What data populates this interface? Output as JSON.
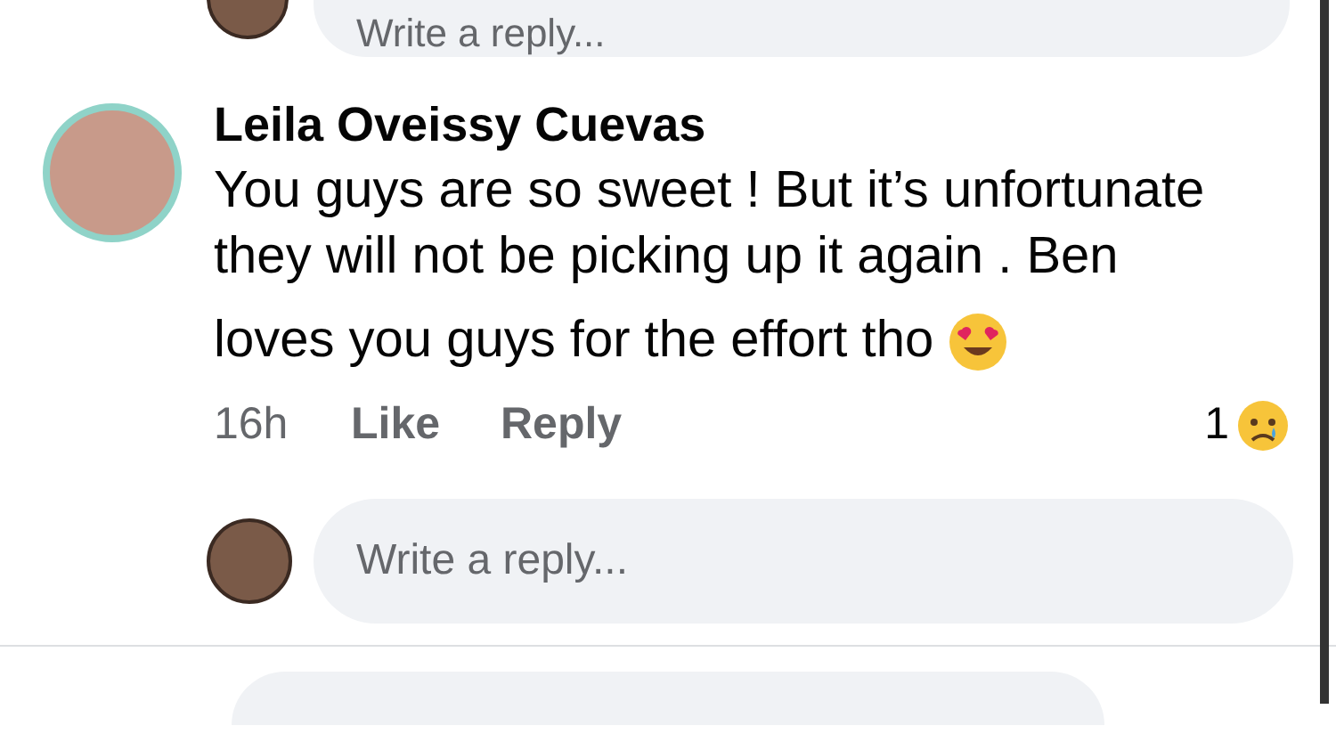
{
  "top_reply_box": {
    "placeholder": "Write a reply..."
  },
  "comment": {
    "author": "Leila Oveissy Cuevas",
    "lines": [
      "You guys are so sweet ! But it’s unfortunate",
      "they will not be picking up it again . Ben",
      "loves you guys for the effort tho"
    ],
    "time": "16h",
    "actions": [
      "Like",
      "Reply"
    ],
    "reaction_count": "1"
  },
  "reply_box": {
    "placeholder": "Write a reply..."
  }
}
